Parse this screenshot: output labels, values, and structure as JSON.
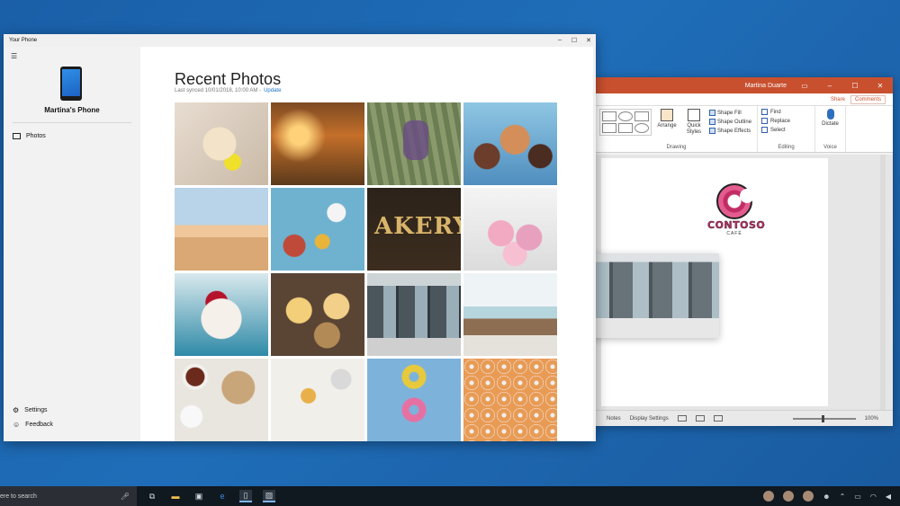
{
  "your_phone": {
    "title": "Your Phone",
    "window_controls": [
      "–",
      "☐",
      "✕"
    ],
    "phone_name": "Martina's Phone",
    "nav": {
      "photos": "Photos",
      "settings": "Settings",
      "feedback": "Feedback"
    },
    "main": {
      "title": "Recent Photos",
      "synced_text": "Last synced 10/01/2018, 10:00 AM -",
      "update_link": "Update"
    },
    "photos": [
      "dog-with-ball",
      "flowers-sunset",
      "shoes-on-grass",
      "family-selfie",
      "beach-kite",
      "baking-ingredients",
      "bakery-sign",
      "pink-meringues",
      "cherry-cheesecake",
      "cupcakes",
      "storefront",
      "cafe-counter",
      "baking-flatlay-eggs",
      "baking-tools",
      "two-donuts",
      "donut-assortment"
    ]
  },
  "powerpoint": {
    "user": "Martina Duarte",
    "share_label": "Share",
    "comments_label": "Comments",
    "ribbon": {
      "arrange": "Arrange",
      "quick_styles": "Quick Styles",
      "shape_fill": "Shape Fill",
      "shape_outline": "Shape Outline",
      "shape_effects": "Shape Effects",
      "drawing_group": "Drawing",
      "find": "Find",
      "replace": "Replace",
      "select": "Select",
      "editing_group": "Editing",
      "dictate": "Dictate",
      "voice_group": "Voice"
    },
    "slide_logo": {
      "name": "CONTOSO",
      "sub": "CAFÉ"
    },
    "status": {
      "notes": "Notes",
      "display_settings": "Display Settings",
      "zoom": "100%"
    }
  },
  "taskbar": {
    "search_placeholder": "ere to search"
  },
  "colors": {
    "desktop": "#1f6db8",
    "ppt_accent": "#c8502f",
    "link": "#1a73c7"
  }
}
